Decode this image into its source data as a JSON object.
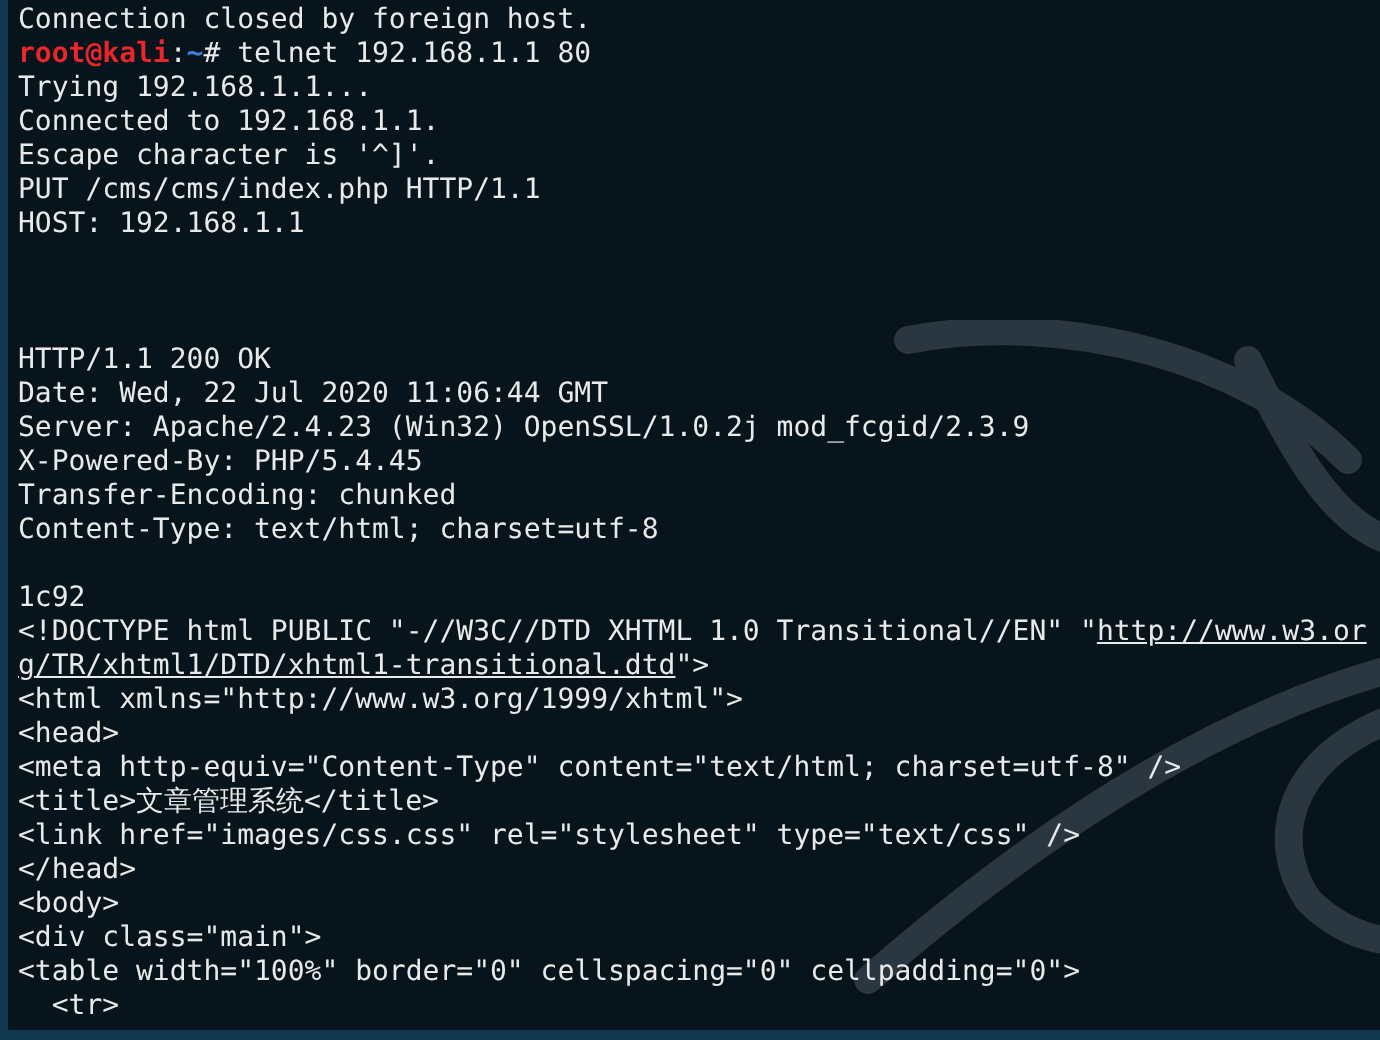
{
  "terminal": {
    "lines": [
      {
        "kind": "text",
        "text": "Connection closed by foreign host."
      },
      {
        "kind": "prompt",
        "user": "root@kali",
        "separator": ":",
        "path": "~",
        "command": "# telnet 192.168.1.1 80"
      },
      {
        "kind": "text",
        "text": "Trying 192.168.1.1..."
      },
      {
        "kind": "text",
        "text": "Connected to 192.168.1.1."
      },
      {
        "kind": "text",
        "text": "Escape character is '^]'."
      },
      {
        "kind": "text",
        "text": "PUT /cms/cms/index.php HTTP/1.1"
      },
      {
        "kind": "text",
        "text": "HOST: 192.168.1.1"
      },
      {
        "kind": "blank"
      },
      {
        "kind": "blank"
      },
      {
        "kind": "blank"
      },
      {
        "kind": "text",
        "text": "HTTP/1.1 200 OK"
      },
      {
        "kind": "text",
        "text": "Date: Wed, 22 Jul 2020 11:06:44 GMT"
      },
      {
        "kind": "text",
        "text": "Server: Apache/2.4.23 (Win32) OpenSSL/1.0.2j mod_fcgid/2.3.9"
      },
      {
        "kind": "text",
        "text": "X-Powered-By: PHP/5.4.45"
      },
      {
        "kind": "text",
        "text": "Transfer-Encoding: chunked"
      },
      {
        "kind": "text",
        "text": "Content-Type: text/html; charset=utf-8"
      },
      {
        "kind": "blank"
      },
      {
        "kind": "text",
        "text": "1c92"
      },
      {
        "kind": "link",
        "before": "<!DOCTYPE html PUBLIC \"-//W3C//DTD XHTML 1.0 Transitional//EN\" \"",
        "link": "http://www.w3.or"
      },
      {
        "kind": "link",
        "link": "g/TR/xhtml1/DTD/xhtml1-transitional.dtd",
        "after": "\">"
      },
      {
        "kind": "text",
        "text": "<html xmlns=\"http://www.w3.org/1999/xhtml\">"
      },
      {
        "kind": "text",
        "text": "<head>"
      },
      {
        "kind": "text",
        "text": "<meta http-equiv=\"Content-Type\" content=\"text/html; charset=utf-8\" />"
      },
      {
        "kind": "text",
        "text": "<title>文章管理系统</title>"
      },
      {
        "kind": "text",
        "text": "<link href=\"images/css.css\" rel=\"stylesheet\" type=\"text/css\" />"
      },
      {
        "kind": "text",
        "text": "</head>"
      },
      {
        "kind": "text",
        "text": "<body>"
      },
      {
        "kind": "text",
        "text": "<div class=\"main\">"
      },
      {
        "kind": "text",
        "text": "<table width=\"100%\" border=\"0\" cellspacing=\"0\" cellpadding=\"0\">"
      },
      {
        "kind": "text",
        "text": "  <tr>"
      }
    ]
  }
}
